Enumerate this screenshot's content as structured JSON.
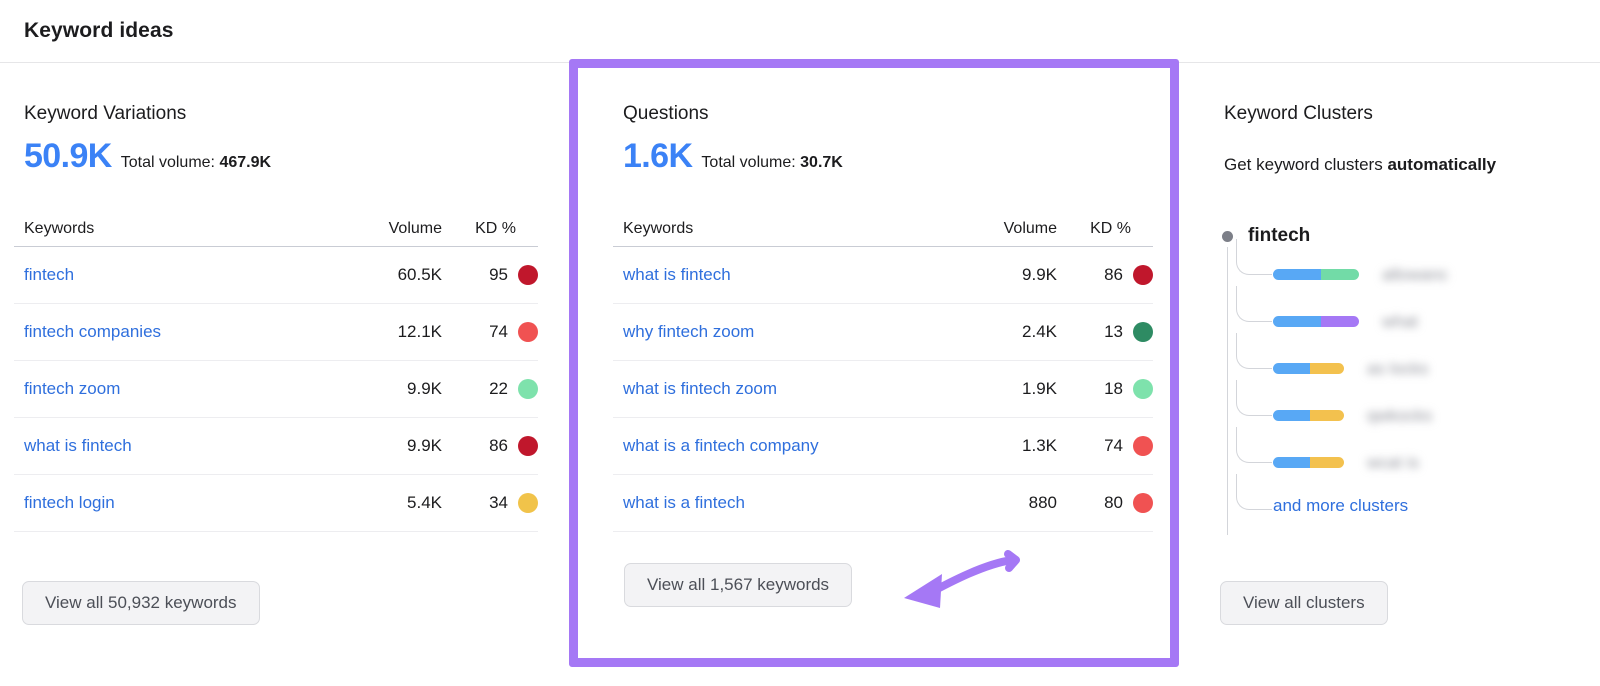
{
  "header": {
    "title": "Keyword ideas"
  },
  "colors": {
    "accent_blue": "#3b82f6",
    "link_blue": "#2f6fdd",
    "highlight_purple": "#a578f5",
    "kd_very_hard": "#c0172c",
    "kd_hard": "#f05252",
    "kd_easy": "#7ee2ac",
    "kd_very_easy": "#2e8b63",
    "kd_medium": "#f1c34a"
  },
  "table_columns": {
    "keywords": "Keywords",
    "volume": "Volume",
    "kd": "KD %"
  },
  "keyword_variations": {
    "title": "Keyword Variations",
    "count": "50.9K",
    "total_volume_label": "Total volume:",
    "total_volume": "467.9K",
    "rows": [
      {
        "keyword": "fintech",
        "volume": "60.5K",
        "kd": "95",
        "dot": "#c0172c"
      },
      {
        "keyword": "fintech companies",
        "volume": "12.1K",
        "kd": "74",
        "dot": "#f05252"
      },
      {
        "keyword": "fintech zoom",
        "volume": "9.9K",
        "kd": "22",
        "dot": "#7ee2ac"
      },
      {
        "keyword": "what is fintech",
        "volume": "9.9K",
        "kd": "86",
        "dot": "#c0172c"
      },
      {
        "keyword": "fintech login",
        "volume": "5.4K",
        "kd": "34",
        "dot": "#f1c34a"
      }
    ],
    "view_all_label": "View all 50,932 keywords"
  },
  "questions": {
    "title": "Questions",
    "count": "1.6K",
    "total_volume_label": "Total volume:",
    "total_volume": "30.7K",
    "rows": [
      {
        "keyword": "what is fintech",
        "volume": "9.9K",
        "kd": "86",
        "dot": "#c0172c"
      },
      {
        "keyword": "why fintech zoom",
        "volume": "2.4K",
        "kd": "13",
        "dot": "#2e8b63"
      },
      {
        "keyword": "what is fintech zoom",
        "volume": "1.9K",
        "kd": "18",
        "dot": "#7ee2ac"
      },
      {
        "keyword": "what is a fintech company",
        "volume": "1.3K",
        "kd": "74",
        "dot": "#f05252"
      },
      {
        "keyword": "what is a fintech",
        "volume": "880",
        "kd": "80",
        "dot": "#f05252"
      }
    ],
    "view_all_label": "View all 1,567 keywords",
    "highlighted": true
  },
  "keyword_clusters": {
    "title": "Keyword Clusters",
    "subtitle_prefix": "Get keyword clusters ",
    "subtitle_emphasis": "automatically",
    "root_label": "fintech",
    "items": [
      {
        "blurred_text": "allowanc",
        "seg1_color": "#58a8f5",
        "seg1_width": 48,
        "seg2_color": "#72dba7",
        "seg2_width": 38
      },
      {
        "blurred_text": "what",
        "seg1_color": "#58a8f5",
        "seg1_width": 48,
        "seg2_color": "#a578f5",
        "seg2_width": 38
      },
      {
        "blurred_text": "as locks",
        "seg1_color": "#58a8f5",
        "seg1_width": 37,
        "seg2_color": "#f3c14e",
        "seg2_width": 34
      },
      {
        "blurred_text": "qwkocks",
        "seg1_color": "#58a8f5",
        "seg1_width": 37,
        "seg2_color": "#f3c14e",
        "seg2_width": 34
      },
      {
        "blurred_text": "wcat is",
        "seg1_color": "#58a8f5",
        "seg1_width": 37,
        "seg2_color": "#f3c14e",
        "seg2_width": 34
      }
    ],
    "more_link": "and more clusters",
    "view_all_label": "View all clusters"
  }
}
